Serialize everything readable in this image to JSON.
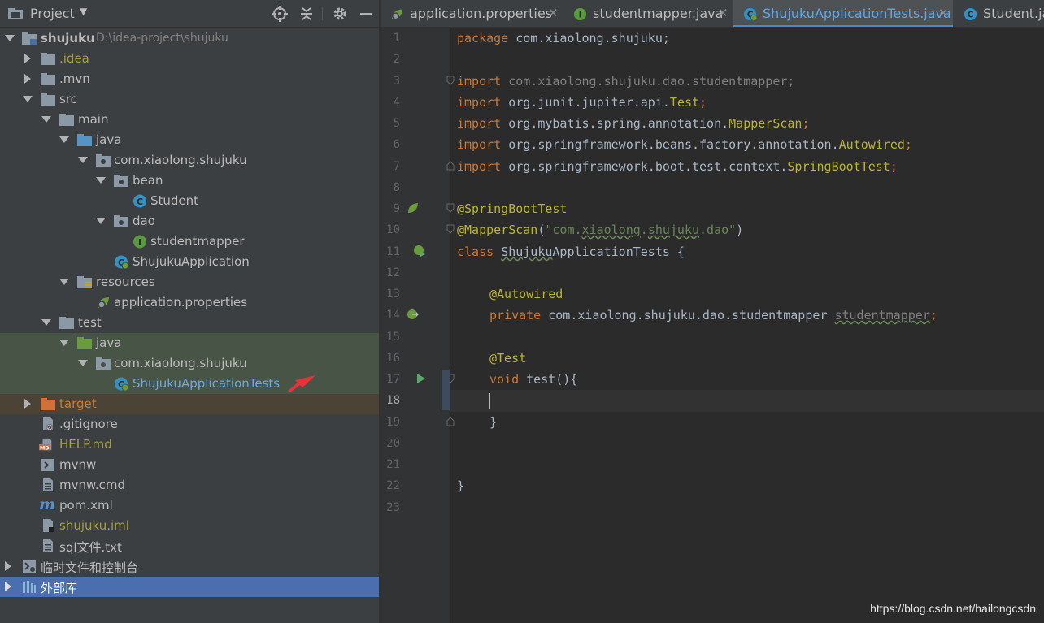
{
  "project_panel": {
    "title": "Project",
    "tree": [
      {
        "label": "shujuku",
        "path": "D:\\idea-project\\shujuku",
        "depth": 0,
        "expanded": true,
        "icon": "module-folder-icon"
      },
      {
        "label": ".idea",
        "depth": 1,
        "expanded": false,
        "icon": "folder-icon"
      },
      {
        "label": ".mvn",
        "depth": 1,
        "expanded": false,
        "icon": "folder-icon"
      },
      {
        "label": "src",
        "depth": 1,
        "expanded": true,
        "icon": "folder-icon"
      },
      {
        "label": "main",
        "depth": 2,
        "expanded": true,
        "icon": "folder-icon"
      },
      {
        "label": "java",
        "depth": 3,
        "expanded": true,
        "icon": "source-folder-icon"
      },
      {
        "label": "com.xiaolong.shujuku",
        "depth": 4,
        "expanded": true,
        "icon": "package-icon"
      },
      {
        "label": "bean",
        "depth": 5,
        "expanded": true,
        "icon": "package-icon"
      },
      {
        "label": "Student",
        "depth": 6,
        "icon": "class-icon"
      },
      {
        "label": "dao",
        "depth": 5,
        "expanded": true,
        "icon": "package-icon"
      },
      {
        "label": "studentmapper",
        "depth": 6,
        "icon": "interface-icon"
      },
      {
        "label": "ShujukuApplication",
        "depth": 5,
        "icon": "spring-boot-class-icon"
      },
      {
        "label": "resources",
        "depth": 3,
        "expanded": true,
        "icon": "resources-folder-icon"
      },
      {
        "label": "application.properties",
        "depth": 4,
        "icon": "spring-properties-icon"
      },
      {
        "label": "test",
        "depth": 2,
        "expanded": true,
        "icon": "folder-icon"
      },
      {
        "label": "java",
        "depth": 3,
        "expanded": true,
        "icon": "test-folder-icon"
      },
      {
        "label": "com.xiaolong.shujuku",
        "depth": 4,
        "expanded": true,
        "icon": "package-icon"
      },
      {
        "label": "ShujukuApplicationTests",
        "depth": 5,
        "icon": "spring-boot-class-icon"
      },
      {
        "label": "target",
        "depth": 1,
        "expanded": false,
        "icon": "excluded-folder-icon"
      },
      {
        "label": ".gitignore",
        "depth": 1,
        "icon": "gitignore-file-icon"
      },
      {
        "label": "HELP.md",
        "depth": 1,
        "icon": "markdown-file-icon"
      },
      {
        "label": "mvnw",
        "depth": 1,
        "icon": "shell-script-icon"
      },
      {
        "label": "mvnw.cmd",
        "depth": 1,
        "icon": "text-file-icon"
      },
      {
        "label": "pom.xml",
        "depth": 1,
        "icon": "maven-icon"
      },
      {
        "label": "shujuku.iml",
        "depth": 1,
        "icon": "iml-file-icon"
      },
      {
        "label": "sql文件.txt",
        "depth": 1,
        "icon": "text-file-icon"
      },
      {
        "label": "临时文件和控制台",
        "depth": 0,
        "expanded": false,
        "icon": "scratches-icon"
      },
      {
        "label": "外部库",
        "depth": 0,
        "expanded": false,
        "icon": "libraries-icon"
      }
    ]
  },
  "tabs": [
    {
      "label": "application.properties",
      "icon": "spring-properties-icon",
      "active": false
    },
    {
      "label": "studentmapper.java",
      "icon": "interface-icon",
      "active": false
    },
    {
      "label": "ShujukuApplicationTests.java",
      "icon": "spring-boot-class-icon",
      "active": true
    },
    {
      "label": "Student.ja",
      "icon": "class-icon",
      "active": false
    }
  ],
  "editor": {
    "current_line": 18,
    "line_numbers": [
      "1",
      "2",
      "3",
      "4",
      "5",
      "6",
      "7",
      "8",
      "9",
      "10",
      "11",
      "12",
      "13",
      "14",
      "15",
      "16",
      "17",
      "18",
      "19",
      "20",
      "21",
      "22",
      "23"
    ],
    "code": {
      "l1_kw": "package",
      "l1_rest": " com.xiaolong.shujuku;",
      "l3_kw": "import",
      "l3_rest": " com.xiaolong.shujuku.dao.studentmapper;",
      "l4_kw": "import",
      "l4_pre": " org.junit.jupiter.api.",
      "l4_cls": "Test",
      "l4_end": ";",
      "l5_kw": "import",
      "l5_pre": " org.mybatis.spring.annotation.",
      "l5_cls": "MapperScan",
      "l5_end": ";",
      "l6_kw": "import",
      "l6_pre": " org.springframework.beans.factory.annotation.",
      "l6_cls": "Autowired",
      "l6_end": ";",
      "l7_kw": "import",
      "l7_pre": " org.springframework.boot.test.context.",
      "l7_cls": "SpringBootTest",
      "l7_end": ";",
      "l9": "@SpringBootTest",
      "l10_an": "@MapperScan",
      "l10_p1": "(",
      "l10_s1": "\"com.",
      "l10_s2": "xiaolong",
      "l10_s3": ".",
      "l10_s4": "shujuku",
      "l10_s5": ".dao\"",
      "l10_p2": ")",
      "l11_kw": "class",
      "l11_sp": " ",
      "l11_name1": "Shujuku",
      "l11_name2": "ApplicationTests",
      "l11_end": " {",
      "l13": "@Autowired",
      "l14_kw": "private",
      "l14_type": " com.xiaolong.shujuku.dao.studentmapper ",
      "l14_field": "studentmapper",
      "l14_end": ";",
      "l16": "@Test",
      "l17_kw": "void",
      "l17_rest": " test(){",
      "l19": "}",
      "l22": "}"
    }
  },
  "watermark": "https://blog.csdn.net/hailongcsdn",
  "colors": {
    "panel_bg": "#3c3f41",
    "editor_bg": "#2b2b2b",
    "gutter_bg": "#313335",
    "selection_blue": "#4b6eaf",
    "test_highlight": "#485445",
    "keyword": "#cc7832",
    "annotation": "#bbb529",
    "string": "#6a8759",
    "red_arrow": "#e8313a"
  }
}
